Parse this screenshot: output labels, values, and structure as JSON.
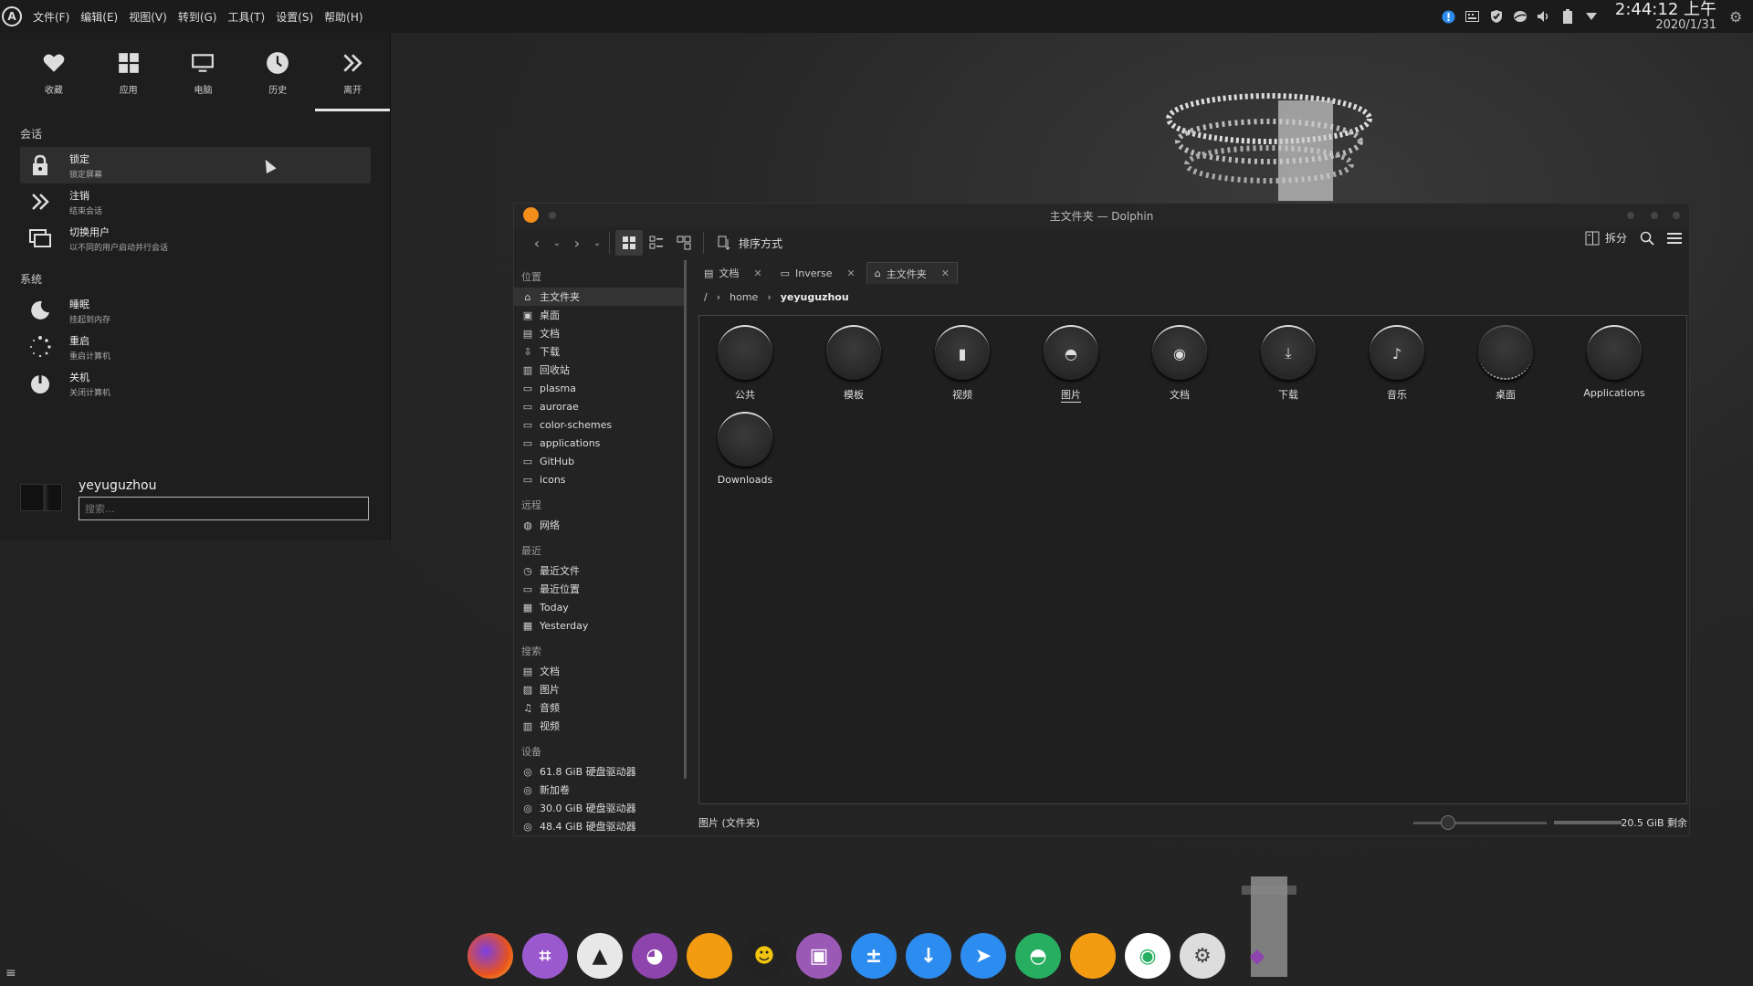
{
  "top_panel": {
    "menus": [
      "文件(F)",
      "编辑(E)",
      "视图(V)",
      "转到(G)",
      "工具(T)",
      "设置(S)",
      "帮助(H)"
    ],
    "clock_time": "2:44:12 上午",
    "clock_date": "2020/1/31",
    "tray_icons": [
      "info-icon",
      "keyboard-icon",
      "shield-icon",
      "network-icon",
      "volume-icon",
      "battery-icon",
      "arrow-down-icon"
    ]
  },
  "start_menu": {
    "tabs": [
      {
        "label": "收藏",
        "icon": "heart-icon"
      },
      {
        "label": "应用",
        "icon": "apps-icon"
      },
      {
        "label": "电脑",
        "icon": "computer-icon"
      },
      {
        "label": "历史",
        "icon": "history-icon"
      },
      {
        "label": "离开",
        "icon": "leave-icon"
      }
    ],
    "session_label": "会话",
    "session_items": [
      {
        "title": "锁定",
        "sub": "锁定屏幕",
        "icon": "lock-icon"
      },
      {
        "title": "注销",
        "sub": "结束会话",
        "icon": "logout-icon"
      },
      {
        "title": "切换用户",
        "sub": "以不同的用户启动并行会话",
        "icon": "switch-user-icon"
      }
    ],
    "system_label": "系统",
    "system_items": [
      {
        "title": "睡眠",
        "sub": "挂起到内存",
        "icon": "sleep-icon"
      },
      {
        "title": "重启",
        "sub": "重启计算机",
        "icon": "restart-icon"
      },
      {
        "title": "关机",
        "sub": "关闭计算机",
        "icon": "power-icon"
      }
    ],
    "username": "yeyuguzhou",
    "search_placeholder": "搜索..."
  },
  "dolphin": {
    "title": "主文件夹 — Dolphin",
    "sort_label": "排序方式",
    "split_label": "拆分",
    "places": {
      "locations_label": "位置",
      "locations": [
        "主文件夹",
        "桌面",
        "文档",
        "下载",
        "回收站",
        "plasma",
        "aurorae",
        "color-schemes",
        "applications",
        "GitHub",
        "icons"
      ],
      "remote_label": "远程",
      "remote": [
        "网络"
      ],
      "recent_label": "最近",
      "recent": [
        "最近文件",
        "最近位置",
        "Today",
        "Yesterday"
      ],
      "search_label": "搜索",
      "search": [
        "文档",
        "图片",
        "音频",
        "视频"
      ],
      "devices_label": "设备",
      "devices": [
        "61.8 GiB 硬盘驱动器",
        "新加卷",
        "30.0 GiB 硬盘驱动器",
        "48.4 GiB 硬盘驱动器"
      ]
    },
    "tabs": [
      {
        "label": "文档",
        "icon": "document-icon"
      },
      {
        "label": "Inverse",
        "icon": "folder-icon"
      },
      {
        "label": "主文件夹",
        "icon": "home-icon"
      }
    ],
    "breadcrumb": {
      "root": "/",
      "home": "home",
      "current": "yeyuguzhou"
    },
    "files": [
      {
        "name": "公共",
        "glyph": ""
      },
      {
        "name": "模板",
        "glyph": ""
      },
      {
        "name": "视频",
        "glyph": "▮"
      },
      {
        "name": "图片",
        "glyph": "◓"
      },
      {
        "name": "文档",
        "glyph": "◉"
      },
      {
        "name": "下载",
        "glyph": "⤓"
      },
      {
        "name": "音乐",
        "glyph": "♪"
      },
      {
        "name": "桌面",
        "glyph": ""
      },
      {
        "name": "Applications",
        "glyph": ""
      },
      {
        "name": "Downloads",
        "glyph": ""
      }
    ],
    "status_text": "图片 (文件夹)",
    "free_space": "20.5 GiB 剩余"
  },
  "dock": [
    {
      "name": "firefox-icon",
      "color": "#e8531e"
    },
    {
      "name": "screenshot-crop-icon",
      "color": "#9b59d0"
    },
    {
      "name": "inkscape-icon",
      "color": "#e8e8e8"
    },
    {
      "name": "github-icon",
      "color": "#8e44ad"
    },
    {
      "name": "folder-orange-icon",
      "color": "#f39c12"
    },
    {
      "name": "qq-icon",
      "color": "#222222"
    },
    {
      "name": "screen-recorder-icon",
      "color": "#9b59b6"
    },
    {
      "name": "calculator-icon",
      "color": "#2d8cf0"
    },
    {
      "name": "downloader-icon",
      "color": "#2d8cf0"
    },
    {
      "name": "telegram-icon",
      "color": "#2d8cf0"
    },
    {
      "name": "android-icon",
      "color": "#27ae60"
    },
    {
      "name": "folder-home-icon",
      "color": "#f39c12"
    },
    {
      "name": "toggle-icon",
      "color": "#27ae60"
    },
    {
      "name": "settings-icon",
      "color": "#dddddd"
    },
    {
      "name": "kdeconnect-icon",
      "color": "#8e44ad"
    }
  ]
}
